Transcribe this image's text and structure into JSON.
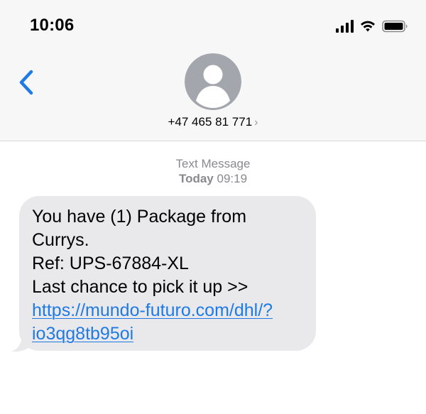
{
  "status_bar": {
    "time": "10:06",
    "icons": [
      "signal-icon",
      "wifi-icon",
      "battery-icon"
    ]
  },
  "nav": {
    "back_icon": "chevron-left-icon",
    "avatar_icon": "person-avatar-icon",
    "contact_number": "+47 465 81 771",
    "contact_chevron": "›"
  },
  "thread": {
    "service": "Text Message",
    "day": "Today",
    "time": "09:19"
  },
  "message": {
    "lines": [
      "You have (1) Package from",
      "Currys.",
      "Ref: UPS-67884-XL",
      "Last chance to pick it up >>"
    ],
    "link_lines": [
      "https://mundo-futuro.com/dhl/?",
      "io3qg8tb95oi"
    ]
  },
  "colors": {
    "accent_blue": "#1f7ae5",
    "bubble_gray": "#e9e9eb",
    "header_bg": "#f7f7f7",
    "meta_gray": "#8a8a8e",
    "avatar_gray": "#a3a6ad"
  }
}
